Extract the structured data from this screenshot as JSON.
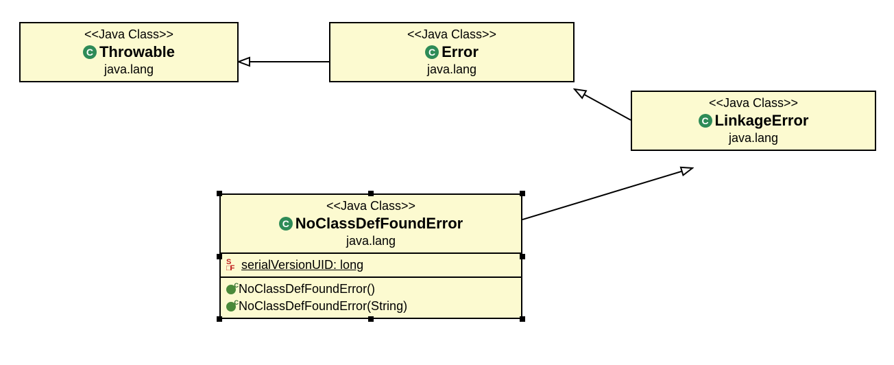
{
  "stereotype_label": "<<Java Class>>",
  "package_label": "java.lang",
  "classes": {
    "throwable": {
      "name": "Throwable"
    },
    "error": {
      "name": "Error"
    },
    "linkage": {
      "name": "LinkageError"
    },
    "noclassdef": {
      "name": "NoClassDefFoundError",
      "field": "serialVersionUID: long",
      "ctor0": "NoClassDefFoundError()",
      "ctor1": "NoClassDefFoundError(String)"
    }
  },
  "chart_data": {
    "type": "uml_class_diagram",
    "nodes": [
      {
        "id": "Throwable",
        "package": "java.lang",
        "stereotype": "Java Class"
      },
      {
        "id": "Error",
        "package": "java.lang",
        "stereotype": "Java Class"
      },
      {
        "id": "LinkageError",
        "package": "java.lang",
        "stereotype": "Java Class"
      },
      {
        "id": "NoClassDefFoundError",
        "package": "java.lang",
        "stereotype": "Java Class",
        "selected": true,
        "fields": [
          {
            "name": "serialVersionUID",
            "type": "long",
            "static": true,
            "final": true
          }
        ],
        "constructors": [
          {
            "signature": "NoClassDefFoundError()"
          },
          {
            "signature": "NoClassDefFoundError(String)"
          }
        ]
      }
    ],
    "edges": [
      {
        "from": "Error",
        "to": "Throwable",
        "kind": "generalization"
      },
      {
        "from": "LinkageError",
        "to": "Error",
        "kind": "generalization"
      },
      {
        "from": "NoClassDefFoundError",
        "to": "LinkageError",
        "kind": "generalization"
      }
    ]
  }
}
